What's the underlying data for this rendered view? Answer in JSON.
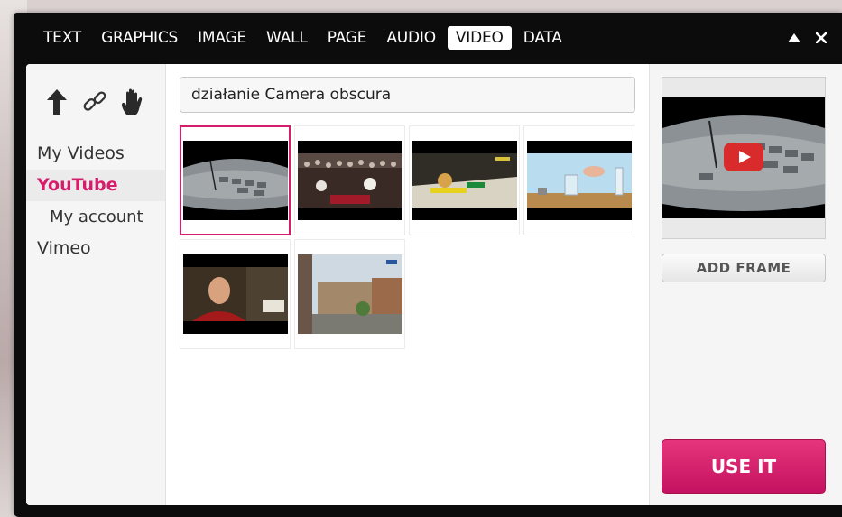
{
  "tabs": [
    {
      "label": "TEXT"
    },
    {
      "label": "GRAPHICS"
    },
    {
      "label": "IMAGE"
    },
    {
      "label": "WALL"
    },
    {
      "label": "PAGE"
    },
    {
      "label": "AUDIO"
    },
    {
      "label": "VIDEO",
      "active": true
    },
    {
      "label": "DATA"
    }
  ],
  "window_controls": {
    "collapse": "▲",
    "close": "✕"
  },
  "toolbar_icons": [
    "arrow-up-icon",
    "link-icon",
    "hand-icon"
  ],
  "sidebar": {
    "items": [
      {
        "label": "My Videos"
      },
      {
        "label": "YouTube",
        "active": true
      },
      {
        "label": "My account",
        "sub": true
      },
      {
        "label": "Vimeo"
      }
    ]
  },
  "search": {
    "value": "działanie Camera obscura"
  },
  "colors": {
    "accent": "#d61c6a",
    "window": "#0c0c0c",
    "panel": "#f5f5f5"
  },
  "preview": {
    "play_icon": "youtube-play-icon"
  },
  "buttons": {
    "add_frame": "ADD FRAME",
    "use_it": "USE IT"
  }
}
